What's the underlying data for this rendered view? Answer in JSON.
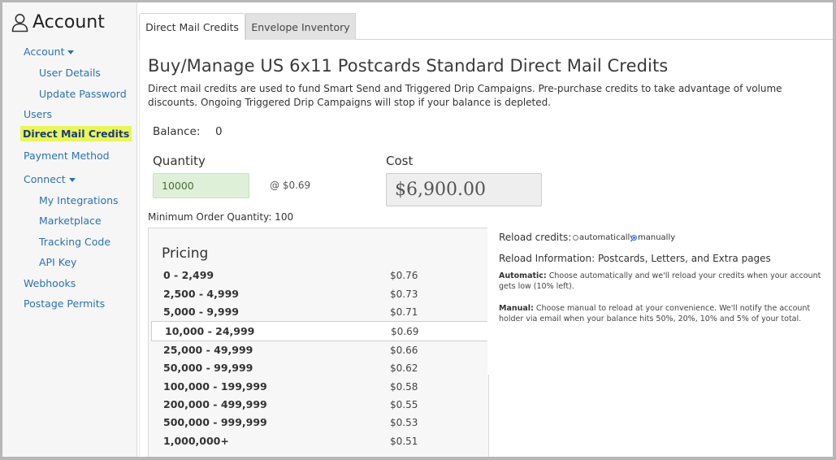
{
  "sidebar": {
    "title": "Account",
    "items": [
      {
        "label": "Account",
        "caret": true
      },
      {
        "label": "User Details"
      },
      {
        "label": "Update Password"
      },
      {
        "label": "Users"
      },
      {
        "label": "Direct Mail Credits",
        "active": true
      },
      {
        "label": "Payment Method"
      },
      {
        "label": "Connect",
        "caret": true
      },
      {
        "label": "My Integrations"
      },
      {
        "label": "Marketplace"
      },
      {
        "label": "Tracking Code"
      },
      {
        "label": "API Key"
      },
      {
        "label": "Webhooks"
      },
      {
        "label": "Postage Permits"
      }
    ]
  },
  "tabs": [
    {
      "label": "Direct Mail Credits",
      "active": true
    },
    {
      "label": "Envelope Inventory",
      "active": false
    }
  ],
  "main": {
    "title": "Buy/Manage US 6x11 Postcards Standard Direct Mail Credits",
    "description": "Direct mail credits are used to fund Smart Send and Triggered Drip Campaigns. Pre-purchase credits to take advantage of volume discounts. Ongoing Triggered Drip Campaigns will stop if your balance is depleted.",
    "balance_label": "Balance:",
    "balance_value": "0",
    "quantity_label": "Quantity",
    "quantity_value": "10000",
    "unit_price": "@ $0.69",
    "cost_label": "Cost",
    "cost_value": "$6,900.00",
    "min_order": "Minimum Order Quantity: 100"
  },
  "pricing": {
    "title": "Pricing",
    "rows": [
      {
        "range": "0 - 2,499",
        "price": "$0.76"
      },
      {
        "range": "2,500 - 4,999",
        "price": "$0.73"
      },
      {
        "range": "5,000 - 9,999",
        "price": "$0.71"
      },
      {
        "range": "10,000 - 24,999",
        "price": "$0.69",
        "selected": true
      },
      {
        "range": "25,000 - 49,999",
        "price": "$0.66"
      },
      {
        "range": "50,000 - 99,999",
        "price": "$0.62"
      },
      {
        "range": "100,000 - 199,999",
        "price": "$0.58"
      },
      {
        "range": "200,000 - 499,999",
        "price": "$0.55"
      },
      {
        "range": "500,000 - 999,999",
        "price": "$0.53"
      },
      {
        "range": "1,000,000+",
        "price": "$0.51"
      }
    ]
  },
  "reload": {
    "label": "Reload credits:",
    "option_auto": "automatically",
    "option_manual": "manually",
    "selected": "manually",
    "info_title": "Reload Information: Postcards, Letters, and Extra pages",
    "automatic_head": "Automatic:",
    "automatic_text": " Choose automatically and we'll reload your credits when your account gets low (10% left).",
    "manual_head": "Manual:",
    "manual_text": " Choose manual to reload at your convenience. We'll notify the account holder via email when your balance hits 50%, 20%, 10% and 5% of your total."
  }
}
